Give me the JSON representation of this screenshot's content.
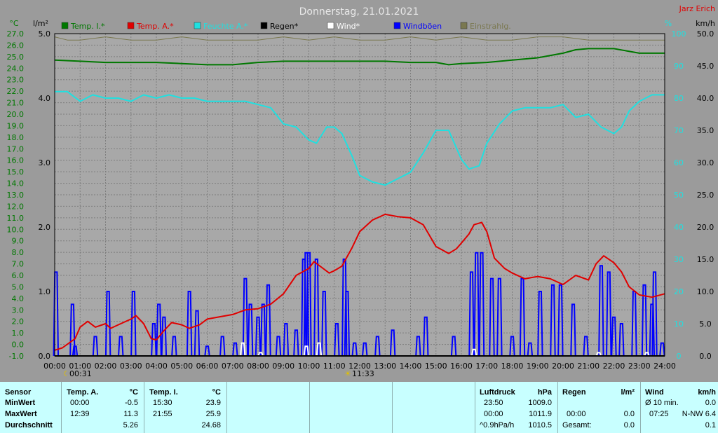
{
  "header": {
    "title": "Donnerstag, 21.01.2021",
    "author": "Jarz Erich",
    "unit_c": "°C",
    "unit_lm2": "l/m²",
    "unit_pct": "%",
    "unit_kmh": "km/h"
  },
  "legend": [
    {
      "label": "Temp. I.*",
      "color": "#007800"
    },
    {
      "label": "Temp. A.*",
      "color": "#e00000"
    },
    {
      "label": "Feuchte A.*",
      "color": "#20e0e0"
    },
    {
      "label": "Regen*",
      "color": "#000000"
    },
    {
      "label": "Wind*",
      "color": "#ffffff"
    },
    {
      "label": "Windböen",
      "color": "#0000ff"
    },
    {
      "label": "Einstrahlg.",
      "color": "#7a7850"
    }
  ],
  "markers": [
    {
      "label": "00:31",
      "symbol": "moon"
    },
    {
      "label": "11:33",
      "symbol": "sun"
    }
  ],
  "chart_data": {
    "type": "line",
    "title": "Donnerstag, 21.01.2021",
    "x_ticks": [
      "00:00",
      "01:00",
      "02:00",
      "03:00",
      "04:00",
      "05:00",
      "06:00",
      "07:00",
      "08:00",
      "09:00",
      "10:00",
      "11:00",
      "12:00",
      "13:00",
      "14:00",
      "15:00",
      "16:00",
      "17:00",
      "18:00",
      "19:00",
      "20:00",
      "21:00",
      "22:00",
      "23:00",
      "24:00"
    ],
    "axes": {
      "temp_c": {
        "ticks": [
          "27.0",
          "26.0",
          "25.0",
          "24.0",
          "23.0",
          "22.0",
          "21.0",
          "20.0",
          "19.0",
          "18.0",
          "17.0",
          "16.0",
          "15.0",
          "14.0",
          "13.0",
          "12.0",
          "11.0",
          "10.0",
          "9.0",
          "8.0",
          "7.0",
          "6.0",
          "5.0",
          "4.0",
          "3.0",
          "2.0",
          "1.0",
          "0.0",
          "-1.0"
        ],
        "range": [
          -1,
          27
        ]
      },
      "rain_lm2": {
        "ticks": [
          "5.0",
          "4.0",
          "3.0",
          "2.0",
          "1.0",
          "0.0"
        ],
        "range": [
          0,
          5
        ]
      },
      "humidity_pct": {
        "ticks": [
          "100",
          "90",
          "80",
          "70",
          "60",
          "50",
          "40",
          "30",
          "20",
          "10",
          "0"
        ],
        "range": [
          0,
          100
        ]
      },
      "wind_kmh": {
        "ticks": [
          "50.0",
          "45.0",
          "40.0",
          "35.0",
          "30.0",
          "25.0",
          "20.0",
          "15.0",
          "10.0",
          "5.0",
          "0.0"
        ],
        "range": [
          0,
          50
        ]
      }
    },
    "grid": true,
    "series": [
      {
        "name": "Temp. I.*",
        "axis": "temp_c",
        "color": "#007800",
        "points": [
          [
            0,
            24.7
          ],
          [
            1,
            24.6
          ],
          [
            2,
            24.5
          ],
          [
            3,
            24.5
          ],
          [
            4,
            24.5
          ],
          [
            5,
            24.4
          ],
          [
            6,
            24.3
          ],
          [
            7,
            24.3
          ],
          [
            8,
            24.5
          ],
          [
            9,
            24.6
          ],
          [
            10,
            24.6
          ],
          [
            11,
            24.6
          ],
          [
            12,
            24.6
          ],
          [
            13,
            24.6
          ],
          [
            14,
            24.5
          ],
          [
            15,
            24.5
          ],
          [
            15.5,
            24.3
          ],
          [
            16,
            24.4
          ],
          [
            17,
            24.5
          ],
          [
            18,
            24.7
          ],
          [
            19,
            24.9
          ],
          [
            20,
            25.3
          ],
          [
            20.5,
            25.6
          ],
          [
            21,
            25.7
          ],
          [
            22,
            25.7
          ],
          [
            22.5,
            25.5
          ],
          [
            23,
            25.3
          ],
          [
            24,
            25.3
          ]
        ]
      },
      {
        "name": "Temp. A.*",
        "axis": "temp_c",
        "color": "#e00000",
        "points": [
          [
            0,
            -0.5
          ],
          [
            0.3,
            -0.3
          ],
          [
            0.8,
            0.5
          ],
          [
            1,
            1.5
          ],
          [
            1.3,
            2.0
          ],
          [
            1.6,
            1.5
          ],
          [
            2,
            1.8
          ],
          [
            2.2,
            1.4
          ],
          [
            2.5,
            1.7
          ],
          [
            3,
            2.2
          ],
          [
            3.2,
            2.5
          ],
          [
            3.5,
            1.8
          ],
          [
            3.8,
            0.5
          ],
          [
            4,
            0.4
          ],
          [
            4.3,
            1.2
          ],
          [
            4.6,
            1.9
          ],
          [
            5,
            1.7
          ],
          [
            5.3,
            1.4
          ],
          [
            5.7,
            1.7
          ],
          [
            6,
            2.2
          ],
          [
            6.5,
            2.4
          ],
          [
            7,
            2.6
          ],
          [
            7.5,
            3.0
          ],
          [
            8,
            3.1
          ],
          [
            8.5,
            3.5
          ],
          [
            9,
            4.4
          ],
          [
            9.5,
            6.0
          ],
          [
            10,
            6.6
          ],
          [
            10.2,
            7.2
          ],
          [
            10.5,
            6.7
          ],
          [
            10.8,
            6.2
          ],
          [
            11,
            6.4
          ],
          [
            11.3,
            6.8
          ],
          [
            11.7,
            8.4
          ],
          [
            12,
            9.8
          ],
          [
            12.5,
            10.8
          ],
          [
            13,
            11.3
          ],
          [
            13.5,
            11.1
          ],
          [
            14,
            11.0
          ],
          [
            14.5,
            10.4
          ],
          [
            15,
            8.5
          ],
          [
            15.5,
            7.9
          ],
          [
            15.8,
            8.3
          ],
          [
            16,
            8.8
          ],
          [
            16.3,
            9.6
          ],
          [
            16.5,
            10.4
          ],
          [
            16.8,
            10.6
          ],
          [
            17,
            9.8
          ],
          [
            17.3,
            7.5
          ],
          [
            17.7,
            6.6
          ],
          [
            18,
            6.2
          ],
          [
            18.5,
            5.7
          ],
          [
            19,
            5.9
          ],
          [
            19.5,
            5.7
          ],
          [
            20,
            5.2
          ],
          [
            20.5,
            6.0
          ],
          [
            21,
            5.6
          ],
          [
            21.3,
            7.0
          ],
          [
            21.6,
            7.7
          ],
          [
            22,
            7.1
          ],
          [
            22.3,
            6.3
          ],
          [
            22.6,
            5.0
          ],
          [
            23,
            4.3
          ],
          [
            23.5,
            4.1
          ],
          [
            24,
            4.4
          ]
        ]
      },
      {
        "name": "Feuchte A.*",
        "axis": "humidity_pct",
        "color": "#20e0e0",
        "points": [
          [
            0,
            82
          ],
          [
            0.5,
            82
          ],
          [
            1,
            79
          ],
          [
            1.5,
            81
          ],
          [
            2,
            80
          ],
          [
            2.5,
            80
          ],
          [
            3,
            79
          ],
          [
            3.5,
            81
          ],
          [
            4,
            80
          ],
          [
            4.5,
            81
          ],
          [
            5,
            80
          ],
          [
            5.5,
            80
          ],
          [
            6,
            79
          ],
          [
            6.5,
            79
          ],
          [
            7,
            79
          ],
          [
            7.5,
            79
          ],
          [
            8,
            78
          ],
          [
            8.5,
            77
          ],
          [
            9,
            72
          ],
          [
            9.5,
            71
          ],
          [
            10,
            67
          ],
          [
            10.3,
            66
          ],
          [
            10.7,
            71
          ],
          [
            11,
            71
          ],
          [
            11.3,
            69
          ],
          [
            11.7,
            62
          ],
          [
            12,
            56
          ],
          [
            12.5,
            54
          ],
          [
            13,
            53
          ],
          [
            13.5,
            55
          ],
          [
            14,
            57
          ],
          [
            14.5,
            63
          ],
          [
            15,
            70
          ],
          [
            15.5,
            70
          ],
          [
            16,
            61
          ],
          [
            16.3,
            58
          ],
          [
            16.7,
            59
          ],
          [
            17,
            66
          ],
          [
            17.5,
            72
          ],
          [
            18,
            76
          ],
          [
            18.5,
            77
          ],
          [
            19,
            77
          ],
          [
            19.5,
            77
          ],
          [
            20,
            78
          ],
          [
            20.5,
            74
          ],
          [
            21,
            75
          ],
          [
            21.5,
            71
          ],
          [
            22,
            69
          ],
          [
            22.3,
            71
          ],
          [
            22.6,
            76
          ],
          [
            23,
            79
          ],
          [
            23.5,
            81
          ],
          [
            24,
            81
          ]
        ]
      },
      {
        "name": "Windböen",
        "axis": "wind_kmh",
        "color": "#0000ff",
        "style": "bars",
        "points": [
          [
            0.05,
            13
          ],
          [
            0.7,
            8
          ],
          [
            0.8,
            1.5
          ],
          [
            1.6,
            3
          ],
          [
            2.1,
            10
          ],
          [
            2.6,
            3
          ],
          [
            3.1,
            10
          ],
          [
            3.9,
            5
          ],
          [
            4.1,
            8
          ],
          [
            4.3,
            6
          ],
          [
            4.7,
            3
          ],
          [
            5.3,
            10
          ],
          [
            5.6,
            7
          ],
          [
            6,
            1.5
          ],
          [
            6.6,
            3
          ],
          [
            7.1,
            2
          ],
          [
            7.5,
            12
          ],
          [
            7.7,
            8
          ],
          [
            8,
            6
          ],
          [
            8.2,
            8
          ],
          [
            8.4,
            11
          ],
          [
            8.8,
            3
          ],
          [
            9.1,
            5
          ],
          [
            9.5,
            4
          ],
          [
            9.8,
            15
          ],
          [
            9.9,
            16
          ],
          [
            10,
            16
          ],
          [
            10.3,
            15
          ],
          [
            10.6,
            10
          ],
          [
            11.1,
            5
          ],
          [
            11.4,
            15
          ],
          [
            11.5,
            10
          ],
          [
            11.8,
            2
          ],
          [
            12.2,
            2
          ],
          [
            12.7,
            3
          ],
          [
            13.3,
            4
          ],
          [
            14.3,
            3
          ],
          [
            14.6,
            6
          ],
          [
            15.7,
            3
          ],
          [
            16.4,
            13
          ],
          [
            16.6,
            16
          ],
          [
            16.8,
            16
          ],
          [
            17.2,
            12
          ],
          [
            17.5,
            12
          ],
          [
            18,
            3
          ],
          [
            18.4,
            12
          ],
          [
            18.7,
            2
          ],
          [
            19.1,
            10
          ],
          [
            19.6,
            11
          ],
          [
            19.9,
            11
          ],
          [
            20.4,
            8
          ],
          [
            20.9,
            3
          ],
          [
            21.5,
            14
          ],
          [
            21.8,
            13
          ],
          [
            22,
            6
          ],
          [
            22.3,
            5
          ],
          [
            22.8,
            10
          ],
          [
            23.2,
            11
          ],
          [
            23.5,
            8
          ],
          [
            23.6,
            13
          ],
          [
            23.9,
            2
          ]
        ]
      },
      {
        "name": "Wind*",
        "axis": "wind_kmh",
        "color": "#ffffff",
        "style": "bars",
        "points": [
          [
            7.4,
            2
          ],
          [
            8.1,
            0.5
          ],
          [
            9.9,
            1.5
          ],
          [
            10.4,
            2
          ],
          [
            16.5,
            1
          ],
          [
            21.4,
            0.5
          ],
          [
            23.3,
            0.5
          ]
        ]
      },
      {
        "name": "Einstrahlg.",
        "axis": "humidity_pct",
        "color": "#7a7850",
        "points": [
          [
            0,
            99
          ],
          [
            0.5,
            98
          ],
          [
            1,
            98
          ],
          [
            2,
            99
          ],
          [
            3,
            98
          ],
          [
            4,
            98
          ],
          [
            5,
            99
          ],
          [
            6,
            98
          ],
          [
            7,
            98
          ],
          [
            8,
            98
          ],
          [
            9,
            99
          ],
          [
            10,
            98
          ],
          [
            11,
            99
          ],
          [
            12,
            98
          ],
          [
            13,
            98
          ],
          [
            14,
            99
          ],
          [
            15,
            98
          ],
          [
            16,
            99
          ],
          [
            17,
            98
          ],
          [
            18,
            98
          ],
          [
            19,
            99
          ],
          [
            20,
            99
          ],
          [
            21,
            98
          ],
          [
            22,
            98
          ],
          [
            23,
            98
          ],
          [
            24,
            98
          ]
        ]
      },
      {
        "name": "Regen*",
        "axis": "rain_lm2",
        "color": "#000000",
        "points": [
          [
            0,
            0
          ],
          [
            24,
            0
          ]
        ]
      }
    ]
  },
  "table": {
    "headers": {
      "sensor": "Sensor",
      "temp_a": "Temp. A.",
      "temp_a_unit": "°C",
      "temp_i": "Temp. I.",
      "temp_i_unit": "°C",
      "pressure": "Luftdruck",
      "pressure_unit": "hPa",
      "rain": "Regen",
      "rain_unit": "l/m²",
      "wind": "Wind",
      "wind_unit": "km/h"
    },
    "rows": [
      {
        "label": "MinWert",
        "temp_a_time": "00:00",
        "temp_a_val": "-0.5",
        "temp_i_time": "15:30",
        "temp_i_val": "23.9",
        "pressure_time": "23:50",
        "pressure_val": "1009.0",
        "rain_time": "",
        "rain_val": "",
        "wind_time": "Ø 10 min.",
        "wind_val": "0.0"
      },
      {
        "label": "MaxWert",
        "temp_a_time": "12:39",
        "temp_a_val": "11.3",
        "temp_i_time": "21:55",
        "temp_i_val": "25.9",
        "pressure_time": "00:00",
        "pressure_val": "1011.9",
        "rain_time": "00:00",
        "rain_val": "0.0",
        "wind_time": "07:25",
        "wind_val": "N-NW 6.4"
      },
      {
        "label": "Durchschnitt",
        "temp_a_time": "",
        "temp_a_val": "5.26",
        "temp_i_time": "",
        "temp_i_val": "24.68",
        "pressure_time": "^0.9hPa/h",
        "pressure_val": "1010.5",
        "rain_time": "Gesamt:",
        "rain_val": "0.0",
        "wind_time": "",
        "wind_val": "0.1"
      }
    ]
  }
}
